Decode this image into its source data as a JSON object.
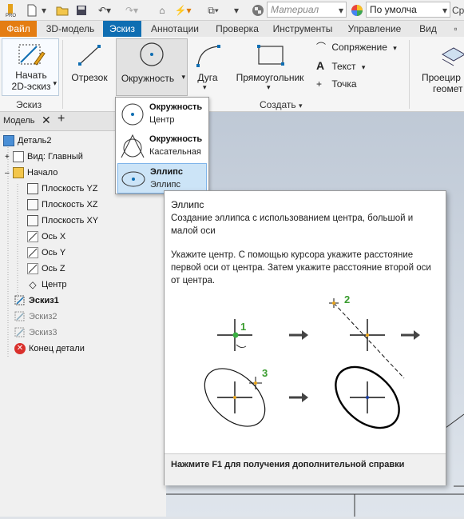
{
  "qat": {
    "material": "Материал",
    "appearance": "По умолча",
    "right_cut": "Ср"
  },
  "tabs": [
    {
      "label": "Файл"
    },
    {
      "label": "3D-модель"
    },
    {
      "label": "Эскиз"
    },
    {
      "label": "Аннотации"
    },
    {
      "label": "Проверка"
    },
    {
      "label": "Инструменты"
    },
    {
      "label": "Управление"
    },
    {
      "label": "Вид"
    }
  ],
  "ribbon": {
    "start_sketch": "Начать\n2D-эскиз",
    "start_sketch_l1": "Начать",
    "start_sketch_l2": "2D-эскиз",
    "line": "Отрезок",
    "circle": "Окружность",
    "arc": "Дуга",
    "rectangle": "Прямоугольник",
    "fillet": "Сопряжение",
    "text": "Текст",
    "point": "Точка",
    "project_l1": "Проецир",
    "project_l2": "геомет",
    "panel_sketch": "Эскиз",
    "panel_create": "Создать"
  },
  "browser": {
    "tab_label": "Модель",
    "items": [
      {
        "label": "Деталь2"
      },
      {
        "label": "Вид: Главный"
      },
      {
        "label": "Начало"
      },
      {
        "label": "Плоскость YZ"
      },
      {
        "label": "Плоскость XZ"
      },
      {
        "label": "Плоскость XY"
      },
      {
        "label": "Ось X"
      },
      {
        "label": "Ось Y"
      },
      {
        "label": "Ось Z"
      },
      {
        "label": "Центр"
      },
      {
        "label": "Эскиз1"
      },
      {
        "label": "Эскиз2"
      },
      {
        "label": "Эскиз3"
      },
      {
        "label": "Конец детали"
      }
    ]
  },
  "dropdown": {
    "items": [
      {
        "title": "Окружность",
        "sub": "Центр"
      },
      {
        "title": "Окружность",
        "sub": "Касательная"
      },
      {
        "title": "Эллипс",
        "sub": "Эллипс"
      }
    ]
  },
  "tooltip": {
    "title": "Эллипс",
    "desc": "Создание эллипса с использованием центра, большой и малой оси",
    "instr": "Укажите центр. С помощью курсора укажите расстояние первой оси от центра. Затем укажите расстояние второй оси от центра.",
    "step1": "1",
    "step2": "2",
    "step3": "3",
    "footer": "Нажмите F1 для получения дополнительной справки"
  }
}
